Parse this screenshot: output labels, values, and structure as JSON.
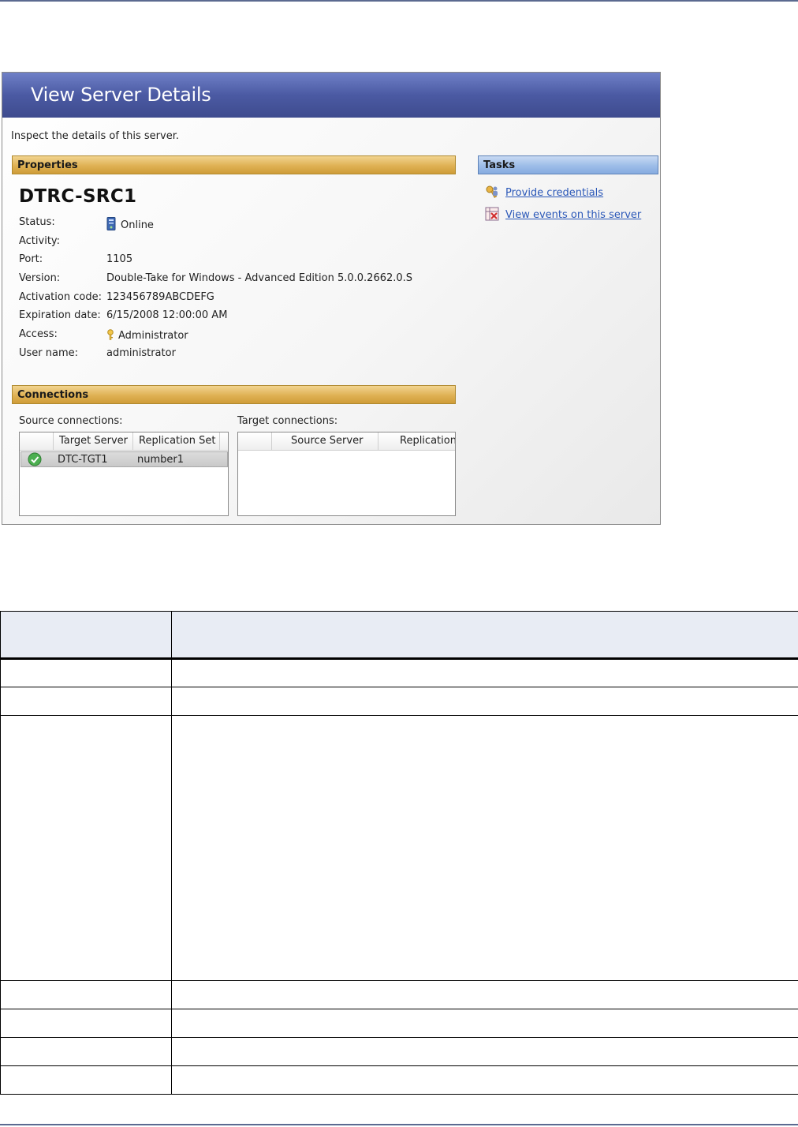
{
  "window": {
    "title": "View Server Details",
    "subtitle": "Inspect the details of this server."
  },
  "properties": {
    "header": "Properties",
    "server_name": "DTRC-SRC1",
    "fields": [
      {
        "label": "Status:",
        "value": "Online",
        "icon": "server-online-icon"
      },
      {
        "label": "Activity:",
        "value": ""
      },
      {
        "label": "Port:",
        "value": "1105"
      },
      {
        "label": "Version:",
        "value": "Double-Take for Windows - Advanced Edition 5.0.0.2662.0.S"
      },
      {
        "label": "Activation code:",
        "value": "123456789ABCDEFG"
      },
      {
        "label": "Expiration date:",
        "value": "6/15/2008 12:00:00 AM"
      },
      {
        "label": "Access:",
        "value": "Administrator",
        "icon": "key-icon"
      },
      {
        "label": "User name:",
        "value": "administrator"
      }
    ]
  },
  "tasks": {
    "header": "Tasks",
    "items": [
      {
        "label": "Provide credentials",
        "icon": "credentials-icon"
      },
      {
        "label": "View events on this server",
        "icon": "events-icon"
      }
    ]
  },
  "connections": {
    "header": "Connections",
    "source": {
      "label": "Source connections:",
      "columns": [
        "Target Server",
        "Replication Set"
      ],
      "rows": [
        {
          "status_icon": "green-check-icon",
          "target_server": "DTC-TGT1",
          "replication_set": "number1"
        }
      ]
    },
    "target": {
      "label": "Target connections:",
      "columns": [
        "Source Server",
        "Replication"
      ],
      "rows": []
    }
  },
  "colors": {
    "header_blue": "#4b5aa3",
    "section_gold": "#dfb154",
    "tasks_blue": "#9dbde8",
    "link": "#2a57b8"
  }
}
